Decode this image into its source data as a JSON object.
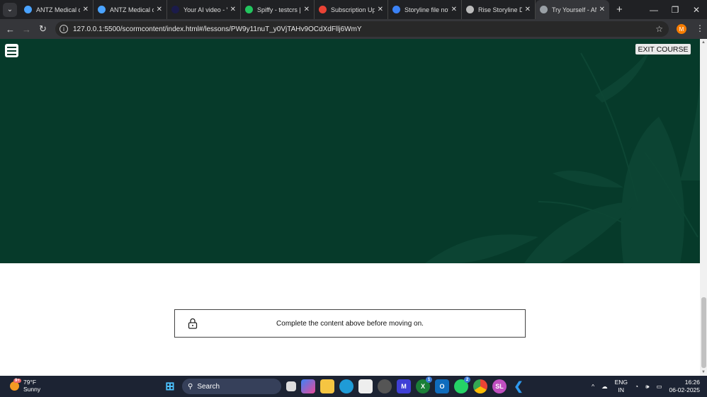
{
  "browser": {
    "tabs": [
      {
        "title": "ANTZ Medical ca",
        "color": "#4aa3ff"
      },
      {
        "title": "ANTZ Medical ca",
        "color": "#4aa3ff"
      },
      {
        "title": "Your AI video - V",
        "color": "#1b1b4a"
      },
      {
        "title": "Spiffy - testcrs | /",
        "color": "#22c55e"
      },
      {
        "title": "Subscription Upc",
        "color": "#ea4335"
      },
      {
        "title": "Storyline file not",
        "color": "#3b82f6"
      },
      {
        "title": "Rise Storyline De",
        "color": "#bbbbbb"
      },
      {
        "title": "Try Yourself - AN",
        "color": "#9aa0a6"
      }
    ],
    "url": "127.0.0.1:5500/scormcontent/index.html#/lessons/PW9y11nuT_y0VjTAHv9OCdXdFllj6WmY",
    "profile_initial": "M"
  },
  "course": {
    "exit_label": "EXIT COURSE",
    "lock_message": "Complete the content above before moving on.",
    "hero_color": "#063a2a"
  },
  "taskbar": {
    "weather_temp": "79°F",
    "weather_desc": "Sunny",
    "weather_badge": "9+",
    "search_label": "Search",
    "xbox_badge": "1",
    "whatsapp_badge": "2",
    "slack_initials": "SL",
    "lang": "ENG",
    "region": "IN",
    "time": "16:26",
    "date": "06-02-2025"
  }
}
